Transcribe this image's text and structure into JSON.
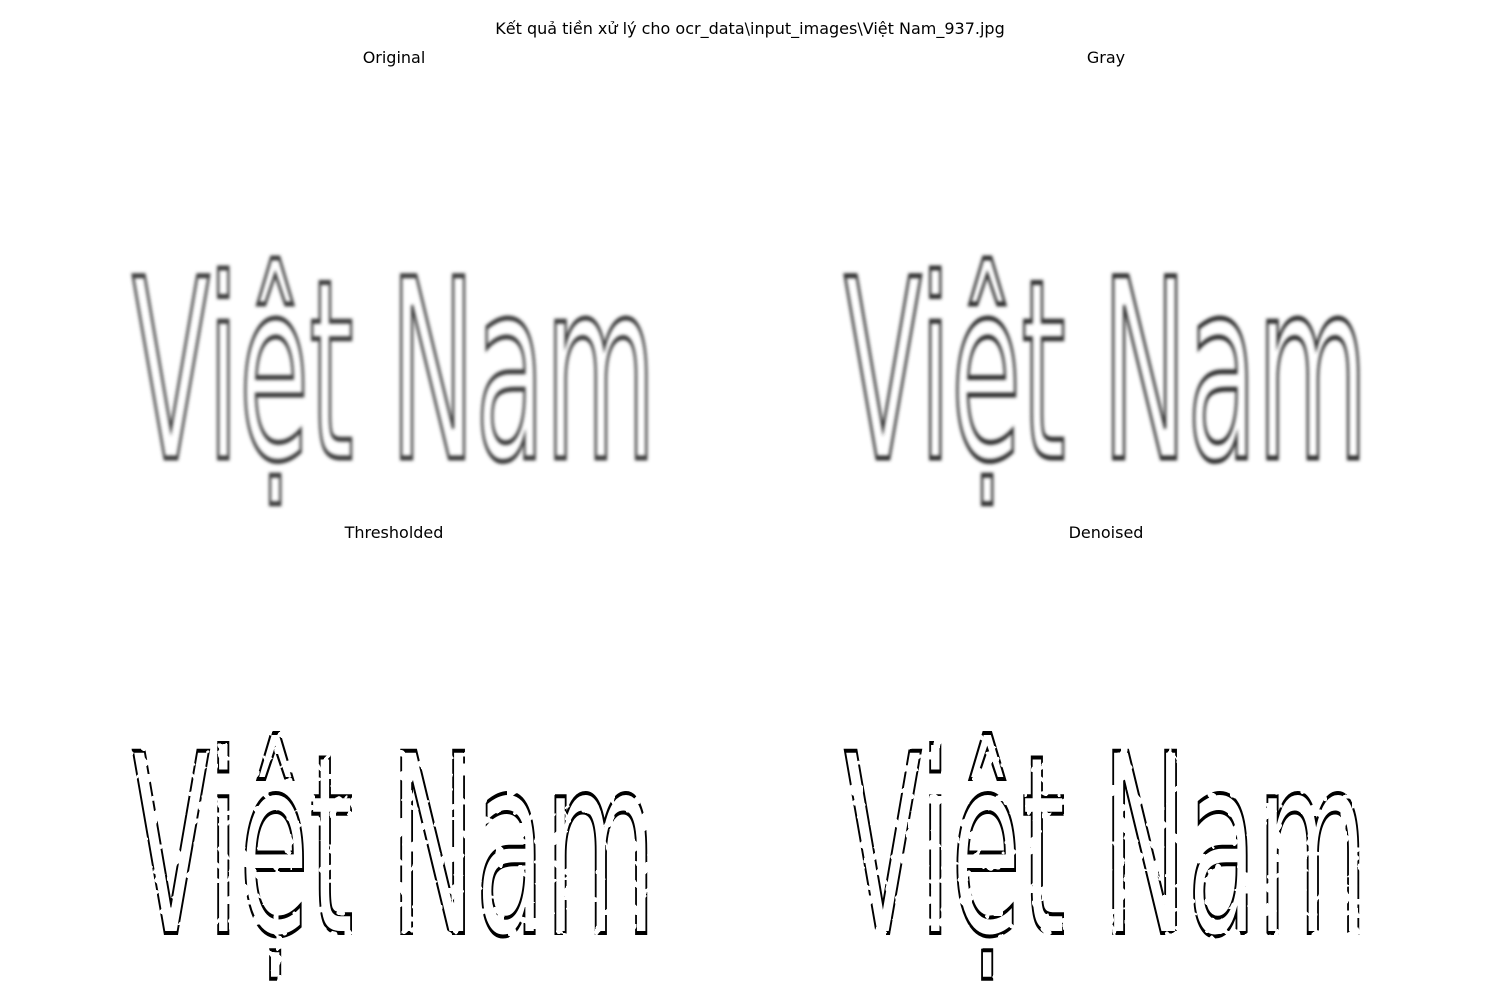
{
  "figure": {
    "suptitle": "Kết quả tiền xử lý cho ocr_data\\input_images\\Việt Nam_937.jpg"
  },
  "panels": [
    {
      "key": "original",
      "title": "Original",
      "word": "Việt Nam",
      "style": "soft",
      "ink": "#3a3a3a"
    },
    {
      "key": "gray",
      "title": "Gray",
      "word": "Việt Nam",
      "style": "soft",
      "ink": "#2e2e2e"
    },
    {
      "key": "thresh",
      "title": "Thresholded",
      "word": "Việt Nam",
      "style": "binary",
      "ink": "#000000"
    },
    {
      "key": "denoise",
      "title": "Denoised",
      "word": "Việt Nam",
      "style": "binary",
      "ink": "#000000"
    }
  ]
}
